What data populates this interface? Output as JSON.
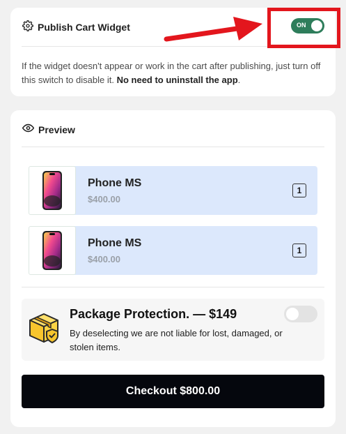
{
  "publish": {
    "title": "Publish Cart Widget",
    "title_icon": "gear-icon",
    "toggle_label": "ON",
    "toggle_state": "on",
    "description": "If the widget doesn't appear or work in the cart after publishing, just turn off this switch to disable it.",
    "description_bold": "No need to uninstall the app",
    "description_end": "."
  },
  "preview": {
    "title": "Preview",
    "title_icon": "eye-icon",
    "items": [
      {
        "name": "Phone MS",
        "price": "$400.00",
        "quantity": "1"
      },
      {
        "name": "Phone MS",
        "price": "$400.00",
        "quantity": "1"
      }
    ],
    "protection": {
      "title": "Package Protection. — $149",
      "description": "By deselecting we are not liable for lost, damaged, or stolen items.",
      "toggle_state": "off"
    },
    "checkout_label": "Checkout $800.00"
  },
  "colors": {
    "toggle_on": "#2e7d5b",
    "highlight": "#e3161d",
    "item_bg": "#dce8fc",
    "checkout_bg": "#05070d"
  }
}
